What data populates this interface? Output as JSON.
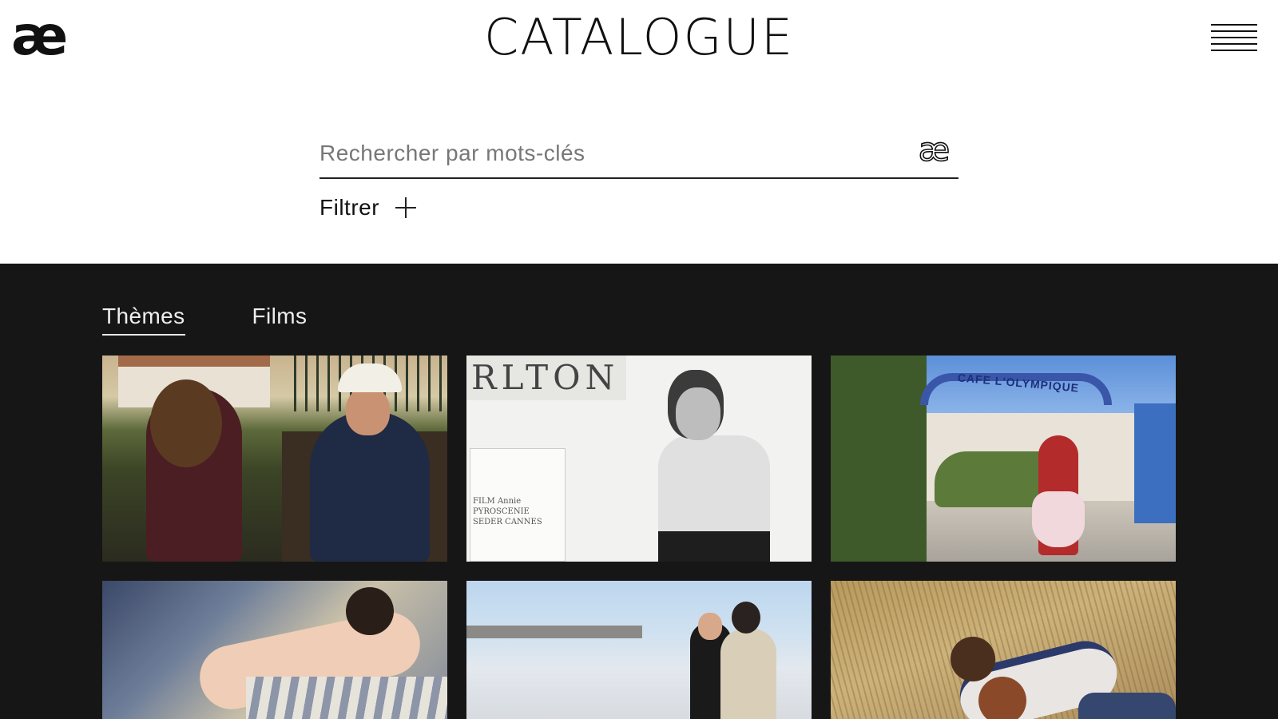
{
  "header": {
    "logo": "æ",
    "title": "CATALOGUE",
    "menu_icon": "hamburger-menu-icon"
  },
  "search": {
    "placeholder": "Rechercher par mots-clés",
    "value": "",
    "icon": "æ"
  },
  "filter": {
    "label": "Filtrer",
    "icon": "plus-icon"
  },
  "tabs": [
    {
      "label": "Thèmes",
      "active": true
    },
    {
      "label": "Films",
      "active": false
    }
  ],
  "cards": [
    {
      "sign_text": "RLTON",
      "clapper_text": "FILM Annie\nPYROSCENIE\nSEDER  CANNES"
    },
    {
      "arch_text": "CAFE L'OLYMPIQUE"
    }
  ],
  "colors": {
    "background": "#ffffff",
    "dark_section": "#161616",
    "text": "#111111",
    "tab_text": "#eeeeee"
  }
}
